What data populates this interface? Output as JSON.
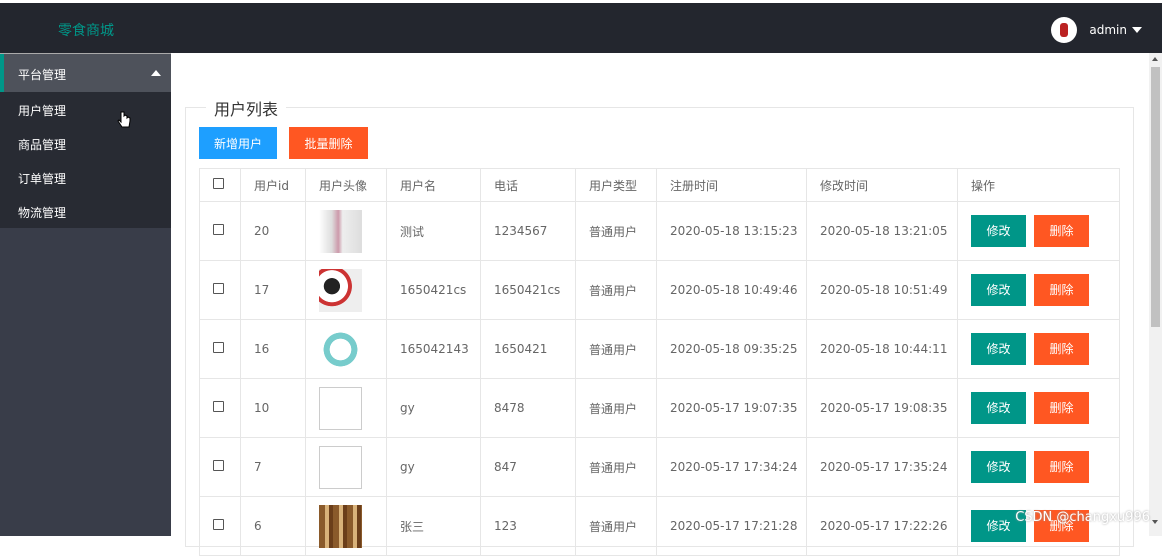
{
  "header": {
    "logo": "零食商城",
    "username": "admin"
  },
  "sidebar": {
    "group": "平台管理",
    "items": [
      "用户管理",
      "商品管理",
      "订单管理",
      "物流管理"
    ]
  },
  "main": {
    "legend": "用户列表",
    "add_button": "新增用户",
    "batch_delete_button": "批量删除",
    "columns": [
      "用户id",
      "用户头像",
      "用户名",
      "电话",
      "用户类型",
      "注册时间",
      "修改时间",
      "操作"
    ],
    "rows": [
      {
        "id": "20",
        "avatar": "image",
        "username": "测试",
        "phone": "1234567",
        "type": "普通用户",
        "created": "2020-05-18 13:15:23",
        "modified": "2020-05-18 13:21:05"
      },
      {
        "id": "17",
        "avatar": "image",
        "username": "1650421cs",
        "phone": "1650421cs",
        "type": "普通用户",
        "created": "2020-05-18 10:49:46",
        "modified": "2020-05-18 10:51:49"
      },
      {
        "id": "16",
        "avatar": "image",
        "username": "165042143",
        "phone": "1650421",
        "type": "普通用户",
        "created": "2020-05-18 09:35:25",
        "modified": "2020-05-18 10:44:11"
      },
      {
        "id": "10",
        "avatar": "broken",
        "username": "gy",
        "phone": "8478",
        "type": "普通用户",
        "created": "2020-05-17 19:07:35",
        "modified": "2020-05-17 19:08:35"
      },
      {
        "id": "7",
        "avatar": "broken",
        "username": "gy",
        "phone": "847",
        "type": "普通用户",
        "created": "2020-05-17 17:34:24",
        "modified": "2020-05-17 17:35:24"
      },
      {
        "id": "6",
        "avatar": "image",
        "username": "张三",
        "phone": "123",
        "type": "普通用户",
        "created": "2020-05-17 17:21:28",
        "modified": "2020-05-17 17:22:26"
      }
    ],
    "edit_label": "修改",
    "delete_label": "删除"
  },
  "watermark": "CSDN @changxu996",
  "colors": {
    "header_bg": "#23262e",
    "sidebar_bg": "#393d49",
    "accent": "#009688",
    "blue": "#1e9fff",
    "orange": "#ff5722"
  }
}
